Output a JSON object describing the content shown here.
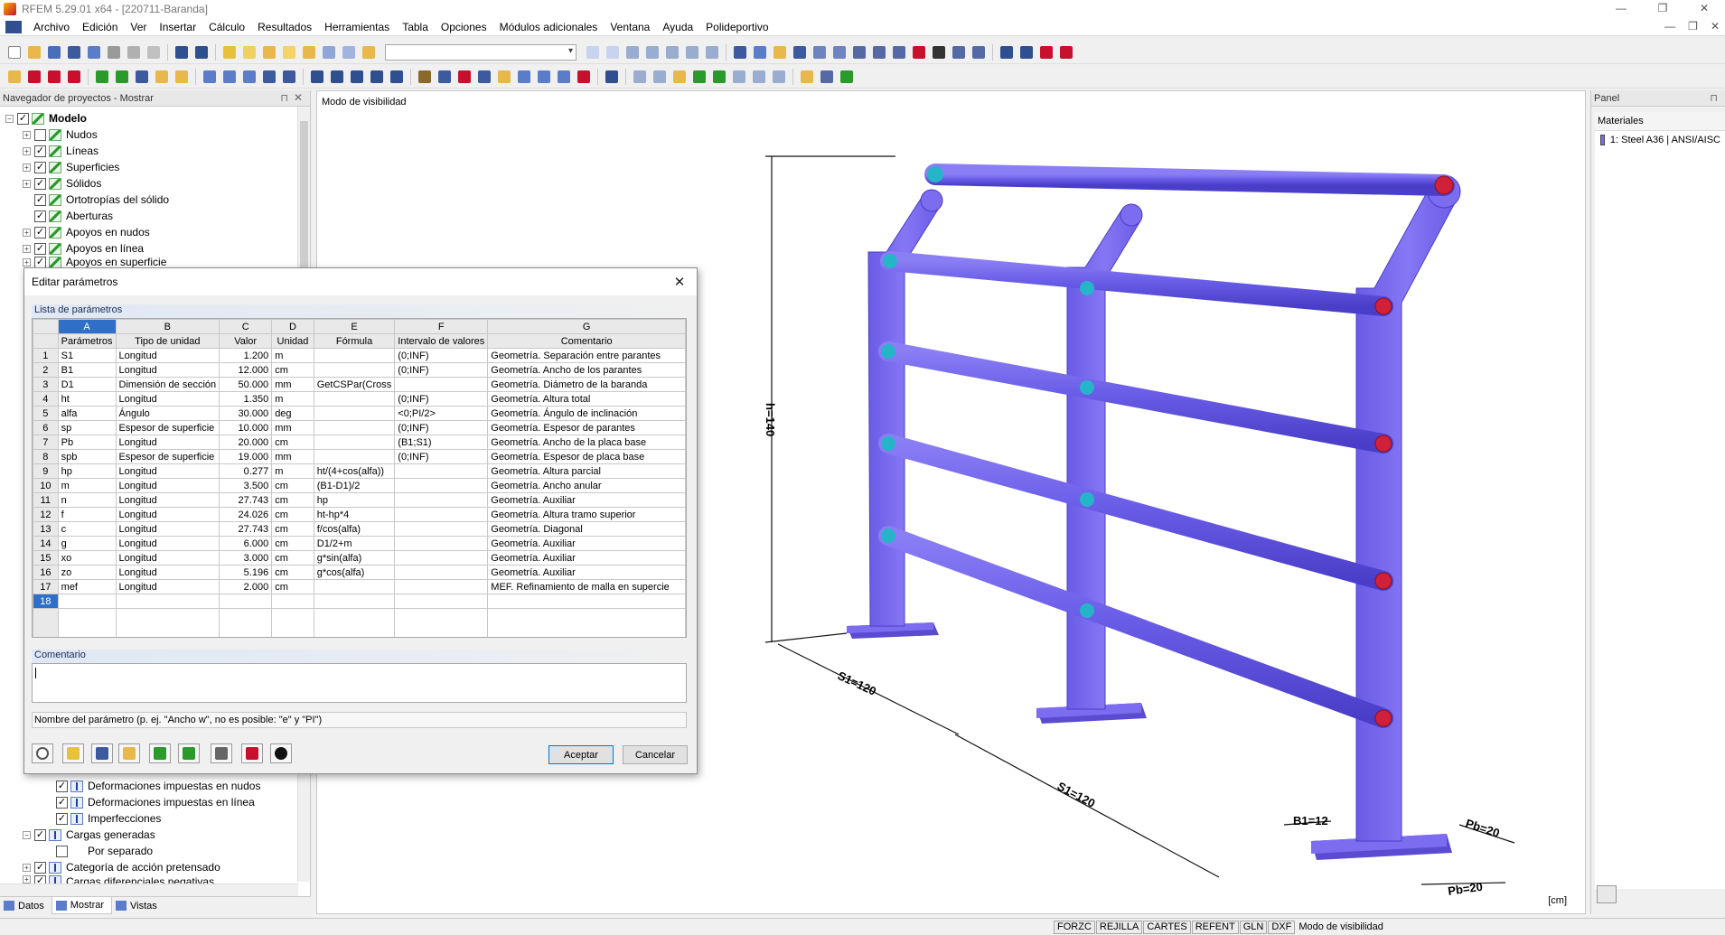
{
  "window": {
    "title": "RFEM 5.29.01 x64 - [220711-Baranda]",
    "controls": [
      "—",
      "❐",
      "✕"
    ]
  },
  "menu": {
    "items": [
      "Archivo",
      "Edición",
      "Ver",
      "Insertar",
      "Cálculo",
      "Resultados",
      "Herramientas",
      "Tabla",
      "Opciones",
      "Módulos adicionales",
      "Ventana",
      "Ayuda",
      "Polideportivo"
    ],
    "mdi_controls": [
      "—",
      "❐",
      "✕"
    ]
  },
  "navigator": {
    "title": "Navegador de proyectos - Mostrar",
    "top_items": [
      {
        "label": "Modelo",
        "bold": true,
        "level": 0
      },
      {
        "label": "Nudos",
        "level": 1,
        "checked": false
      },
      {
        "label": "Líneas",
        "level": 1,
        "checked": true
      },
      {
        "label": "Superficies",
        "level": 1,
        "checked": true
      },
      {
        "label": "Sólidos",
        "level": 1,
        "checked": true
      },
      {
        "label": "Ortotropías del sólido",
        "level": 1,
        "checked": true
      },
      {
        "label": "Aberturas",
        "level": 1,
        "checked": true
      },
      {
        "label": "Apoyos en nudos",
        "level": 1,
        "checked": true
      },
      {
        "label": "Apoyos en línea",
        "level": 1,
        "checked": true
      },
      {
        "label": "Apoyos en superficie",
        "level": 1,
        "checked": true
      }
    ],
    "bottom_items": [
      {
        "label": "Deformaciones impuestas en nudos",
        "level": 2,
        "checked": true
      },
      {
        "label": "Deformaciones impuestas en línea",
        "level": 2,
        "checked": true
      },
      {
        "label": "Imperfecciones",
        "level": 2,
        "checked": true
      },
      {
        "label": "Cargas generadas",
        "level": 1,
        "checked": true
      },
      {
        "label": "Por separado",
        "level": 2,
        "checked": false
      },
      {
        "label": "Categoría de acción pretensado",
        "level": 1,
        "checked": true
      },
      {
        "label": "Cargas diferenciales negativas",
        "level": 1,
        "checked": true
      }
    ],
    "tabs": [
      "Datos",
      "Mostrar",
      "Vistas"
    ],
    "active_tab": "Mostrar"
  },
  "viewport": {
    "title": "Modo de visibilidad",
    "units": "[cm]",
    "dimensions": {
      "height": "h=140",
      "s1_a": "S1=120",
      "s1_b": "S1=120",
      "b1": "B1=12",
      "pb_a": "Pb=20",
      "pb_b": "Pb=20"
    },
    "colors": {
      "post": "#7b6cf0",
      "post_dark": "#5a4bd1",
      "rail": "#6a5de8",
      "rail_end": "#d0203a",
      "rail_ring": "#26b4c8"
    }
  },
  "panel": {
    "title": "Panel",
    "section": "Materiales",
    "materials": [
      {
        "label": "1: Steel A36 | ANSI/AISC",
        "color": "#7b6cf0"
      }
    ]
  },
  "statusbar": {
    "cells": [
      "FORZC",
      "REJILLA",
      "CARTES",
      "REFENT",
      "GLN",
      "DXF"
    ],
    "text": "Modo de visibilidad"
  },
  "dialog": {
    "title": "Editar parámetros",
    "section_title": "Lista de parámetros",
    "column_letters": [
      "A",
      "B",
      "C",
      "D",
      "E",
      "F",
      "G"
    ],
    "column_headers": [
      "Parámetros",
      "Tipo de unidad",
      "Valor",
      "Unidad",
      "Fórmula",
      "Intervalo de valores",
      "Comentario"
    ],
    "rows": [
      [
        "1",
        "S1",
        "Longitud",
        "1.200",
        "m",
        "",
        "(0;INF)",
        "Geometría. Separación entre parantes"
      ],
      [
        "2",
        "B1",
        "Longitud",
        "12.000",
        "cm",
        "",
        "(0;INF)",
        "Geometría. Ancho de los parantes"
      ],
      [
        "3",
        "D1",
        "Dimensión de sección",
        "50.000",
        "mm",
        "GetCSPar(Cross",
        "",
        "Geometría. Diámetro de la baranda"
      ],
      [
        "4",
        "ht",
        "Longitud",
        "1.350",
        "m",
        "",
        "(0;INF)",
        "Geometría. Altura total"
      ],
      [
        "5",
        "alfa",
        "Ángulo",
        "30.000",
        "deg",
        "",
        "<0;PI/2>",
        "Geometría. Ángulo de inclinación"
      ],
      [
        "6",
        "sp",
        "Espesor de superficie",
        "10.000",
        "mm",
        "",
        "(0;INF)",
        "Geometría. Espesor de parantes"
      ],
      [
        "7",
        "Pb",
        "Longitud",
        "20.000",
        "cm",
        "",
        "(B1;S1)",
        "Geometría. Ancho de la placa base"
      ],
      [
        "8",
        "spb",
        "Espesor de superficie",
        "19.000",
        "mm",
        "",
        "(0;INF)",
        "Geometría. Espesor de placa base"
      ],
      [
        "9",
        "hp",
        "Longitud",
        "0.277",
        "m",
        "ht/(4+cos(alfa))",
        "",
        "Geometría. Altura parcial"
      ],
      [
        "10",
        "m",
        "Longitud",
        "3.500",
        "cm",
        "(B1-D1)/2",
        "",
        "Geometría. Ancho anular"
      ],
      [
        "11",
        "n",
        "Longitud",
        "27.743",
        "cm",
        "hp",
        "",
        "Geometría. Auxiliar"
      ],
      [
        "12",
        "f",
        "Longitud",
        "24.026",
        "cm",
        "ht-hp*4",
        "",
        "Geometría. Altura tramo superior"
      ],
      [
        "13",
        "c",
        "Longitud",
        "27.743",
        "cm",
        "f/cos(alfa)",
        "",
        "Geometría. Diagonal"
      ],
      [
        "14",
        "g",
        "Longitud",
        "6.000",
        "cm",
        "D1/2+m",
        "",
        "Geometría. Auxiliar"
      ],
      [
        "15",
        "xo",
        "Longitud",
        "3.000",
        "cm",
        "g*sin(alfa)",
        "",
        "Geometría. Auxiliar"
      ],
      [
        "16",
        "zo",
        "Longitud",
        "5.196",
        "cm",
        "g*cos(alfa)",
        "",
        "Geometría. Auxiliar"
      ],
      [
        "17",
        "mef",
        "Longitud",
        "2.000",
        "cm",
        "",
        "",
        "MEF. Refinamiento de malla en supercie"
      ],
      [
        "18",
        "",
        "",
        "",
        "",
        "",
        "",
        ""
      ]
    ],
    "active_row": "18",
    "comment_title": "Comentario",
    "comment_value": "",
    "hint": "Nombre del parámetro (p. ej. \"Ancho w\", no es posible: \"e\" y \"PI\")",
    "accept_label": "Aceptar",
    "cancel_label": "Cancelar"
  }
}
